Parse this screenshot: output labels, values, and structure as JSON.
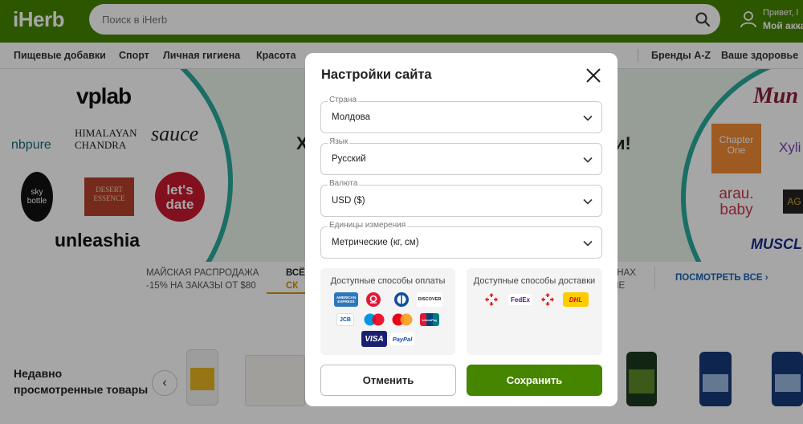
{
  "header": {
    "logo": "iHerb",
    "search_placeholder": "Поиск в iHerb",
    "account_greeting": "Привет, l",
    "account_label": "Мой акка"
  },
  "nav": {
    "items": [
      "Пищевые добавки",
      "Спорт",
      "Личная гигиена",
      "Красота",
      "Бренды A-Z",
      "Ваше здоровье"
    ]
  },
  "hero": {
    "headline_left": "Х",
    "headline_right": "и!",
    "brands_left": [
      "vplab",
      "nbpure",
      "HIMALAYAN CHANDRA",
      "sauce",
      "sky bottle",
      "DESERT ESSENCE",
      "let's date",
      "unleashia"
    ],
    "brands_right": [
      "Mun",
      "Chapter One",
      "Xyli",
      "arau. baby",
      "AG",
      "MUSCL"
    ]
  },
  "promo": {
    "item1_line1": "МАЙСКАЯ РАСПРОДАЖА",
    "item1_line2": "-15% НА ЗАКАЗЫ ОТ $80",
    "item2_line1": "ВСЁ",
    "item2_line2": "СК",
    "item3_line1": "ИНАХ",
    "item3_line2": "ШЕ",
    "see_all": "ПОСМОТРЕТЬ ВСЕ"
  },
  "recent": {
    "title_line1": "Недавно",
    "title_line2": "просмотренные товары",
    "prev_arrow": "‹"
  },
  "modal": {
    "title": "Настройки сайта",
    "country_label": "Страна",
    "country_value": "Молдова",
    "language_label": "Язык",
    "language_value": "Русский",
    "currency_label": "Валюта",
    "currency_value": "USD ($)",
    "units_label": "Единицы измерения",
    "units_value": "Метрические (кг, см)",
    "payment_title": "Доступные способы оплаты",
    "delivery_title": "Доступные способы доставки",
    "payment_methods": [
      "AMERICAN EXPRESS",
      "DISCOVER",
      "JCB",
      "UnionPay",
      "VISA",
      "PayPal"
    ],
    "delivery_methods": [
      "FedEx",
      "DHL"
    ],
    "cancel_label": "Отменить",
    "save_label": "Сохранить"
  }
}
